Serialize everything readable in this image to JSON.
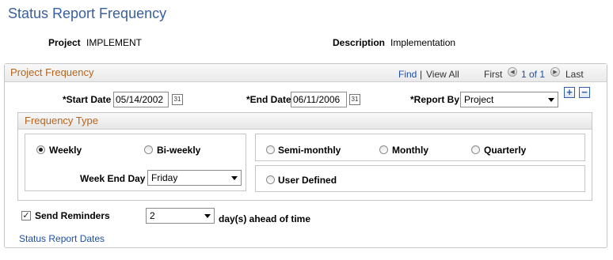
{
  "page": {
    "title": "Status Report Frequency"
  },
  "header": {
    "project_label": "Project",
    "project_value": "IMPLEMENT",
    "description_label": "Description",
    "description_value": "Implementation"
  },
  "project_frequency": {
    "title": "Project Frequency",
    "find": "Find",
    "separator": "|",
    "view_all": "View All",
    "first": "First",
    "position": "1 of 1",
    "last": "Last",
    "start_date_label": "*Start Date",
    "start_date": "05/14/2002",
    "end_date_label": "*End Date",
    "end_date": "06/11/2006",
    "report_by_label": "*Report By",
    "report_by": "Project",
    "add_symbol": "+",
    "remove_symbol": "−"
  },
  "frequency_type": {
    "title": "Frequency Type",
    "weekly": "Weekly",
    "biweekly": "Bi-weekly",
    "week_end_day_label": "Week End Day",
    "week_end_day": "Friday",
    "semimonthly": "Semi-monthly",
    "monthly": "Monthly",
    "quarterly": "Quarterly",
    "user_defined": "User Defined",
    "selected": "Weekly"
  },
  "reminders": {
    "label": "Send Reminders",
    "checked": true,
    "days": "2",
    "suffix": "day(s) ahead of time"
  },
  "links": {
    "status_report_dates": "Status Report Dates"
  }
}
